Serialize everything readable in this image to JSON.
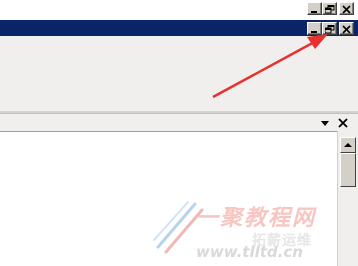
{
  "watermark": {
    "logo_text": "一聚教程网",
    "sub_text": "拓薪运维",
    "url": "www.tlltd.cn"
  },
  "colors": {
    "title_bar": "#0a246a",
    "annotation_arrow": "#e8312e",
    "button_face": "#d4d0c8"
  },
  "icons": {
    "minimize": "minimize-icon",
    "restore": "restore-icon",
    "close": "close-icon",
    "dropdown": "chevron-down-icon",
    "scroll_up": "arrow-up-icon"
  }
}
